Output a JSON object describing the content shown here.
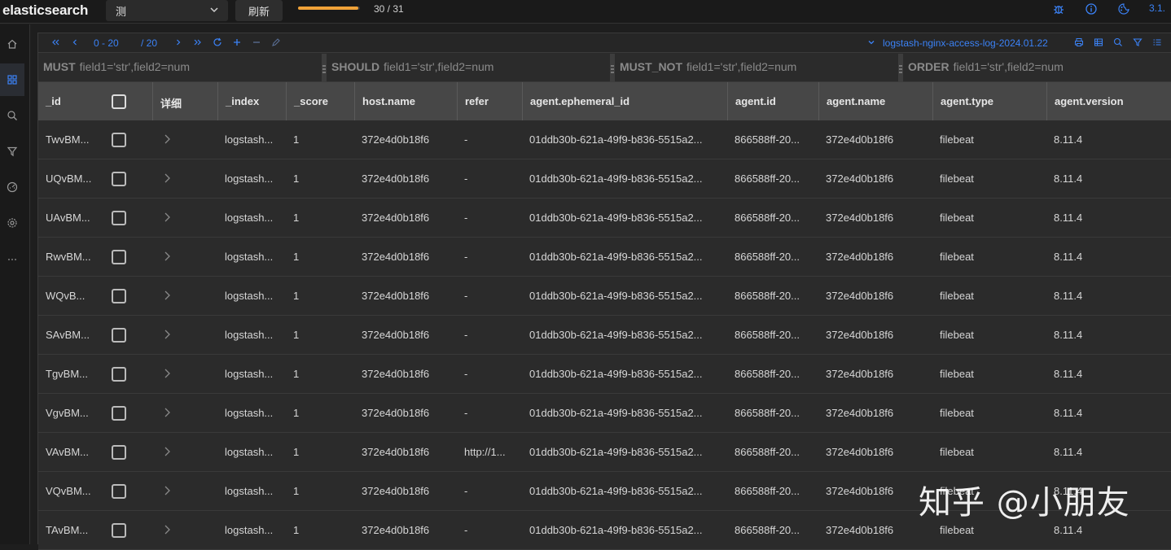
{
  "app": {
    "brand": "elasticsearch",
    "connection": "测",
    "refresh_label": "刷新",
    "progress": {
      "current": 30,
      "total": 31,
      "text": "30 / 31"
    },
    "version": "3.1.",
    "accent_color": "#3b82f6",
    "progress_color": "#f0a238"
  },
  "top_icons": [
    "bug-icon",
    "info-icon",
    "theme-icon"
  ],
  "sidenav": [
    "home-icon",
    "grid-icon",
    "search-icon",
    "filter-icon",
    "chart-icon",
    "settings-icon",
    "more-icon"
  ],
  "toolbar": {
    "range": "0 - 20",
    "total": "/ 20",
    "index_name": "logstash-nginx-access-log-2024.01.22",
    "left_icons": [
      "first-page-icon",
      "prev-page-icon",
      "next-page-icon",
      "last-page-icon",
      "reload-icon",
      "add-icon",
      "remove-icon",
      "edit-icon"
    ],
    "right_icons": [
      "print-icon",
      "table-icon",
      "search-icon",
      "filter-icon",
      "columns-icon"
    ]
  },
  "filters": [
    {
      "label": "MUST",
      "placeholder": "field1='str',field2=num"
    },
    {
      "label": "SHOULD",
      "placeholder": "field1='str',field2=num"
    },
    {
      "label": "MUST_NOT",
      "placeholder": "field1='str',field2=num"
    },
    {
      "label": "ORDER",
      "placeholder": "field1='str',field2=num"
    }
  ],
  "table": {
    "columns": [
      "_id",
      "",
      "详细",
      "_index",
      "_score",
      "host.name",
      "refer",
      "agent.ephemeral_id",
      "agent.id",
      "agent.name",
      "agent.type",
      "agent.version"
    ],
    "rows": [
      [
        "TwvBM...",
        "logstash...",
        "1",
        "372e4d0b18f6",
        "-",
        "01ddb30b-621a-49f9-b836-5515a2...",
        "866588ff-20...",
        "372e4d0b18f6",
        "filebeat",
        "8.11.4"
      ],
      [
        "UQvBM...",
        "logstash...",
        "1",
        "372e4d0b18f6",
        "-",
        "01ddb30b-621a-49f9-b836-5515a2...",
        "866588ff-20...",
        "372e4d0b18f6",
        "filebeat",
        "8.11.4"
      ],
      [
        "UAvBM...",
        "logstash...",
        "1",
        "372e4d0b18f6",
        "-",
        "01ddb30b-621a-49f9-b836-5515a2...",
        "866588ff-20...",
        "372e4d0b18f6",
        "filebeat",
        "8.11.4"
      ],
      [
        "RwvBM...",
        "logstash...",
        "1",
        "372e4d0b18f6",
        "-",
        "01ddb30b-621a-49f9-b836-5515a2...",
        "866588ff-20...",
        "372e4d0b18f6",
        "filebeat",
        "8.11.4"
      ],
      [
        "WQvB...",
        "logstash...",
        "1",
        "372e4d0b18f6",
        "-",
        "01ddb30b-621a-49f9-b836-5515a2...",
        "866588ff-20...",
        "372e4d0b18f6",
        "filebeat",
        "8.11.4"
      ],
      [
        "SAvBM...",
        "logstash...",
        "1",
        "372e4d0b18f6",
        "-",
        "01ddb30b-621a-49f9-b836-5515a2...",
        "866588ff-20...",
        "372e4d0b18f6",
        "filebeat",
        "8.11.4"
      ],
      [
        "TgvBM...",
        "logstash...",
        "1",
        "372e4d0b18f6",
        "-",
        "01ddb30b-621a-49f9-b836-5515a2...",
        "866588ff-20...",
        "372e4d0b18f6",
        "filebeat",
        "8.11.4"
      ],
      [
        "VgvBM...",
        "logstash...",
        "1",
        "372e4d0b18f6",
        "-",
        "01ddb30b-621a-49f9-b836-5515a2...",
        "866588ff-20...",
        "372e4d0b18f6",
        "filebeat",
        "8.11.4"
      ],
      [
        "VAvBM...",
        "logstash...",
        "1",
        "372e4d0b18f6",
        "http://1...",
        "01ddb30b-621a-49f9-b836-5515a2...",
        "866588ff-20...",
        "372e4d0b18f6",
        "filebeat",
        "8.11.4"
      ],
      [
        "VQvBM...",
        "logstash...",
        "1",
        "372e4d0b18f6",
        "-",
        "01ddb30b-621a-49f9-b836-5515a2...",
        "866588ff-20...",
        "372e4d0b18f6",
        "filebeat",
        "8.11.4"
      ],
      [
        "TAvBM...",
        "logstash...",
        "1",
        "372e4d0b18f6",
        "-",
        "01ddb30b-621a-49f9-b836-5515a2...",
        "866588ff-20...",
        "372e4d0b18f6",
        "filebeat",
        "8.11.4"
      ]
    ]
  },
  "watermark": "知乎 @小朋友"
}
